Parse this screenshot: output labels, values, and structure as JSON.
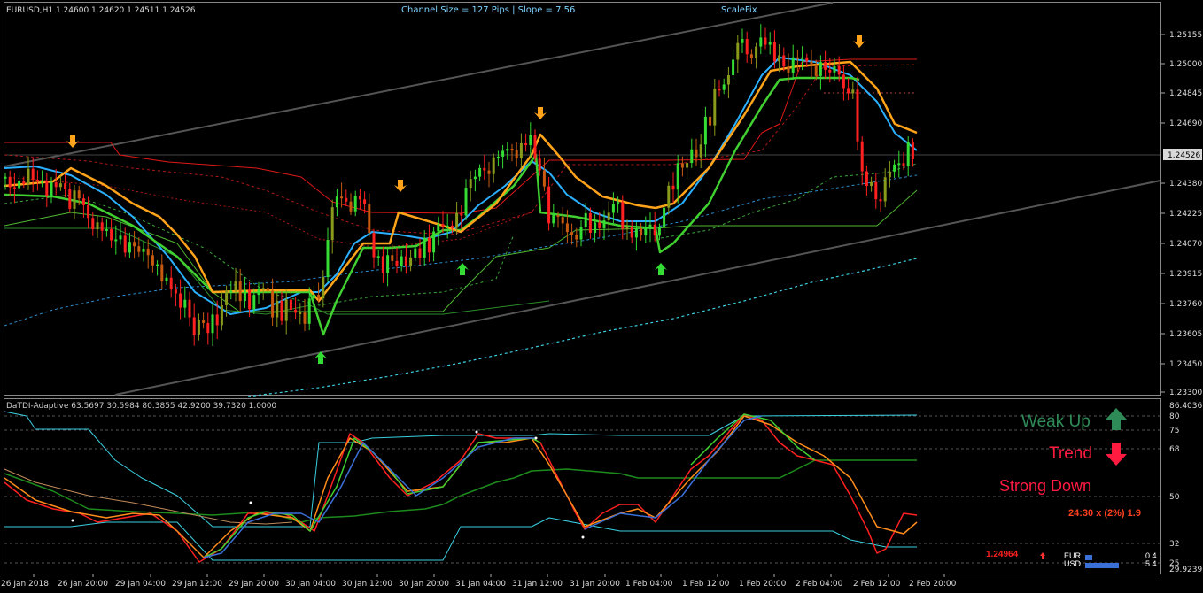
{
  "header": {
    "symbol_info": "EURUSD,H1  1.24600 1.24620 1.24511 1.24526",
    "channel_info": "Channel Size = 127 Pips  |  Slope = 7.56",
    "scalefix": "ScaleFix"
  },
  "price_axis": {
    "ticks": [
      "1.25155",
      "1.25000",
      "1.24845",
      "1.24690",
      "1.24380",
      "1.24225",
      "1.24070",
      "1.23915",
      "1.23760",
      "1.23605",
      "1.23450",
      "1.23300"
    ],
    "current_price": "1.24526"
  },
  "time_axis": {
    "labels": [
      "26 Jan 2018",
      "26 Jan 20:00",
      "29 Jan 04:00",
      "29 Jan 12:00",
      "29 Jan 20:00",
      "30 Jan 04:00",
      "30 Jan 12:00",
      "30 Jan 20:00",
      "31 Jan 04:00",
      "31 Jan 12:00",
      "31 Jan 20:00",
      "1 Feb 04:00",
      "1 Feb 12:00",
      "1 Feb 20:00",
      "2 Feb 04:00",
      "2 Feb 12:00",
      "2 Feb 20:00"
    ]
  },
  "sub_window": {
    "title": "DaTDI-Adaptive 63.5697 30.5984 80.3855 42.9200 39.7320 1.0000",
    "axis_top": "86.4036",
    "axis_bottom": "29.9239",
    "levels": [
      "80",
      "75",
      "68",
      "50",
      "32",
      "25"
    ]
  },
  "panel": {
    "weak_up": "Weak Up",
    "trend": "Trend",
    "strong_down": "Strong Down",
    "timer": "24:30 x (2%) 1.9",
    "price": "1.24964",
    "cur1": "EUR",
    "val1": "0.4",
    "cur2": "USD",
    "val2": "5.4"
  },
  "colors": {
    "up": "#33dd33",
    "down": "#ff2020",
    "olive": "#8a9a1a",
    "orange": "#ffa31a",
    "blue": "#2ab0ff",
    "lime": "#40d030",
    "weak_up": "#2e8b57",
    "trend": "#ff1a40"
  }
}
